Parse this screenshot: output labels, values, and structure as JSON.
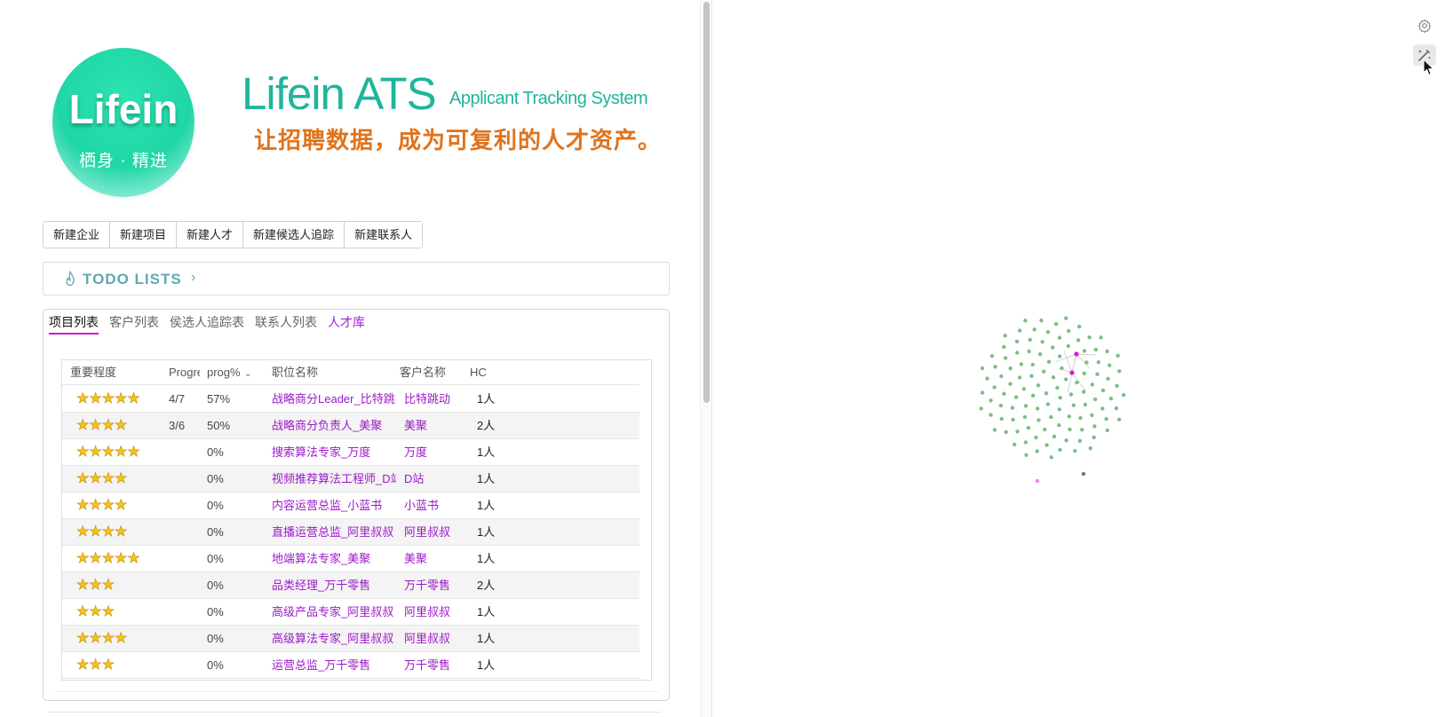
{
  "logo": {
    "word": "Lifein",
    "slogan": "栖身 · 精进"
  },
  "brand": {
    "title": "Lifein ATS",
    "subtitle": "Applicant Tracking System",
    "tagline": "让招聘数据，成为可复利的人才资产。"
  },
  "actions": [
    "新建企业",
    "新建项目",
    "新建人才",
    "新建候选人追踪",
    "新建联系人"
  ],
  "todo": {
    "label": "TODO LISTS",
    "chevron": "›"
  },
  "tabs": [
    {
      "label": "项目列表",
      "active": true
    },
    {
      "label": "客户列表"
    },
    {
      "label": "侯选人追踪表"
    },
    {
      "label": "联系人列表"
    },
    {
      "label": "人才库",
      "color": "#a020d8"
    }
  ],
  "table": {
    "headers": [
      "重要程度",
      "Progre",
      "prog%",
      "职位名称",
      "客户名称",
      "HC"
    ],
    "rows": [
      {
        "stars": 5,
        "progress": "4/7",
        "pct": "57%",
        "title": "战略商分Leader_比特跳",
        "client": "比特跳动",
        "hc": "1人"
      },
      {
        "stars": 4,
        "progress": "3/6",
        "pct": "50%",
        "title": "战略商分负责人_美聚",
        "client": "美聚",
        "hc": "2人"
      },
      {
        "stars": 5,
        "progress": "",
        "pct": "0%",
        "title": "搜索算法专家_万度",
        "client": "万度",
        "hc": "1人"
      },
      {
        "stars": 4,
        "progress": "",
        "pct": "0%",
        "title": "视频推荐算法工程师_D站",
        "client": "D站",
        "hc": "1人"
      },
      {
        "stars": 4,
        "progress": "",
        "pct": "0%",
        "title": "内容运营总监_小蓝书",
        "client": "小蓝书",
        "hc": "1人"
      },
      {
        "stars": 4,
        "progress": "",
        "pct": "0%",
        "title": "直播运营总监_阿里叔叔",
        "client": "阿里叔叔",
        "hc": "1人"
      },
      {
        "stars": 5,
        "progress": "",
        "pct": "0%",
        "title": "地端算法专家_美聚",
        "client": "美聚",
        "hc": "1人"
      },
      {
        "stars": 3,
        "progress": "",
        "pct": "0%",
        "title": "品类经理_万千零售",
        "client": "万千零售",
        "hc": "2人"
      },
      {
        "stars": 3,
        "progress": "",
        "pct": "0%",
        "title": "高级产品专家_阿里叔叔",
        "client": "阿里叔叔",
        "hc": "1人"
      },
      {
        "stars": 4,
        "progress": "",
        "pct": "0%",
        "title": "高级算法专家_阿里叔叔",
        "client": "阿里叔叔",
        "hc": "1人"
      },
      {
        "stars": 3,
        "progress": "",
        "pct": "0%",
        "title": "运营总监_万千零售",
        "client": "万千零售",
        "hc": "1人"
      }
    ]
  },
  "graph": {
    "node_color": "#7cbf84",
    "hub_color": "#d61bd6",
    "edge_color": "#c9c9c9"
  },
  "icons": {
    "settings": "gear-icon",
    "magic": "wand-icon",
    "todo": "flame-icon"
  }
}
